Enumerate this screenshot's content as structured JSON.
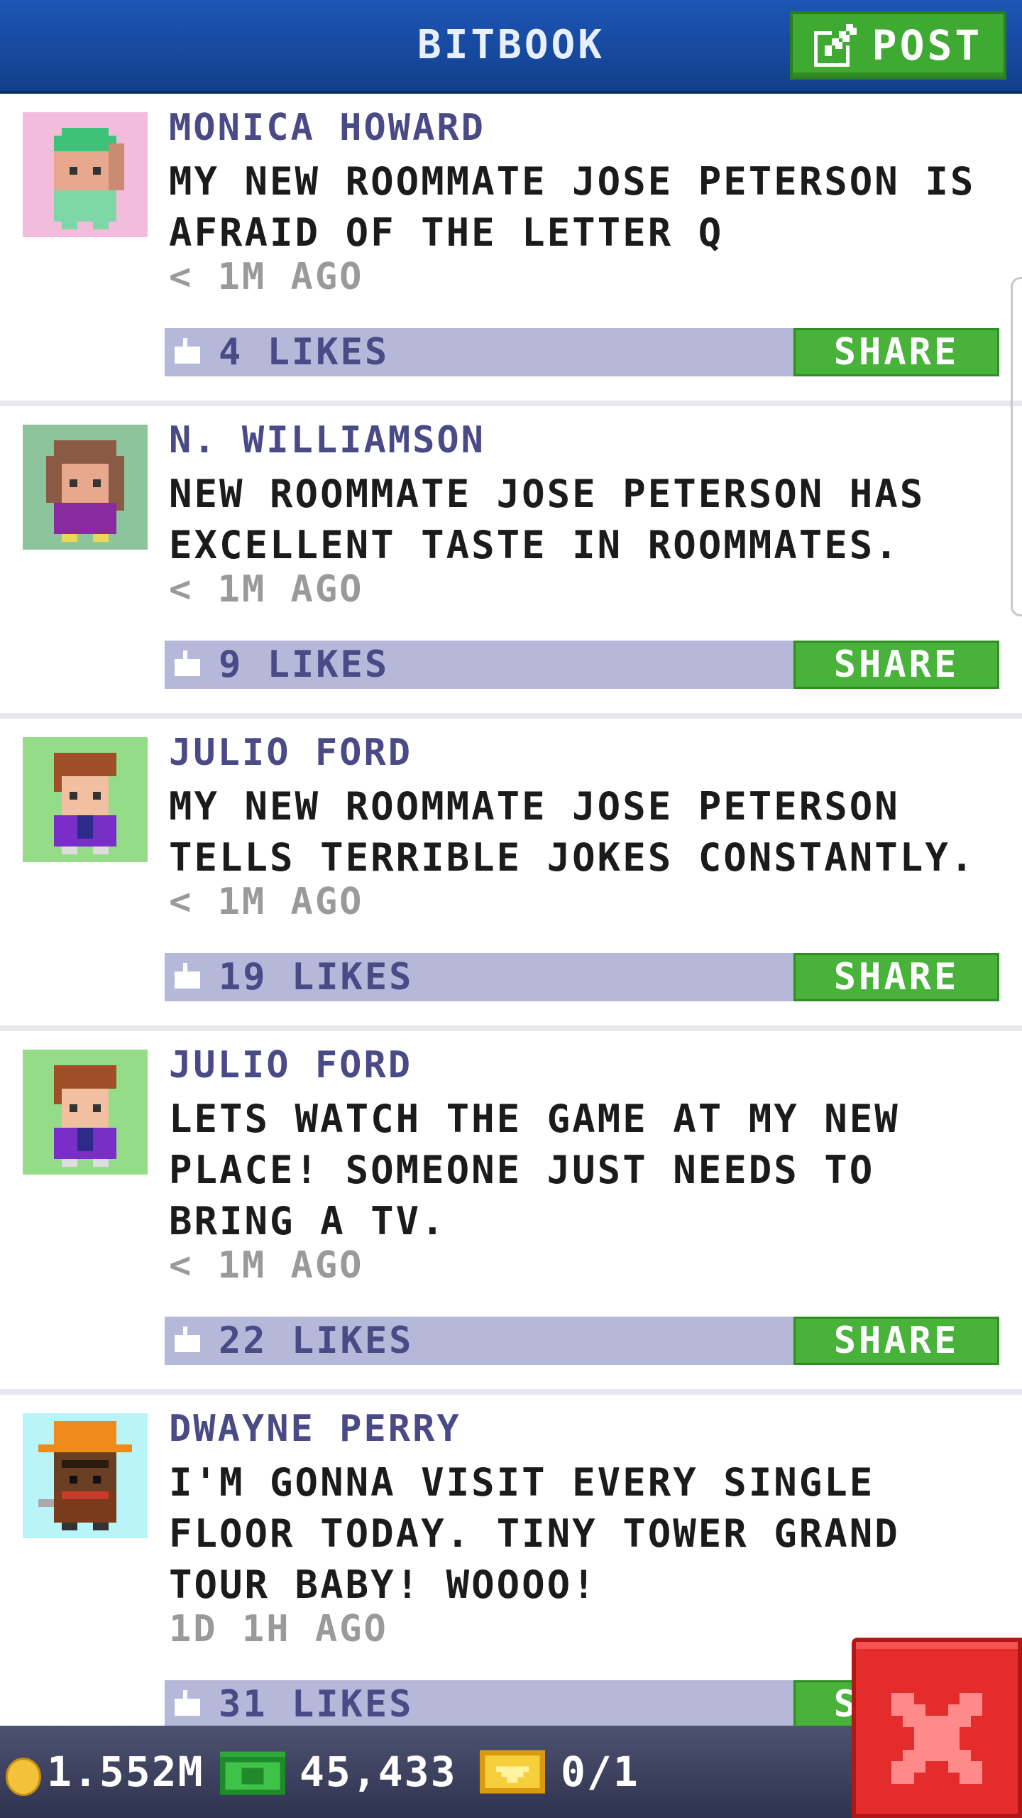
{
  "header": {
    "title": "BITBOOK",
    "post_label": "POST"
  },
  "posts": [
    {
      "author": "MONICA HOWARD",
      "message": "MY NEW ROOMMATE JOSE PETERSON IS AFRAID OF THE LETTER Q",
      "time": "< 1M AGO",
      "likes": "4 LIKES",
      "share": "SHARE",
      "avatar_bg": "#f4bcdc"
    },
    {
      "author": "N. WILLIAMSON",
      "message": "NEW ROOMMATE JOSE PETERSON HAS EXCELLENT TASTE IN ROOMMATES.",
      "time": "< 1M AGO",
      "likes": "9 LIKES",
      "share": "SHARE",
      "avatar_bg": "#8cc49b"
    },
    {
      "author": "JULIO FORD",
      "message": "MY NEW ROOMMATE JOSE PETERSON TELLS TERRIBLE JOKES CONSTANTLY.",
      "time": "< 1M AGO",
      "likes": "19 LIKES",
      "share": "SHARE",
      "avatar_bg": "#94dc88"
    },
    {
      "author": "JULIO FORD",
      "message": "LETS WATCH THE GAME AT MY NEW PLACE! SOMEONE JUST NEEDS TO BRING A TV.",
      "time": "< 1M AGO",
      "likes": "22 LIKES",
      "share": "SHARE",
      "avatar_bg": "#94dc88"
    },
    {
      "author": "DWAYNE PERRY",
      "message": "I'M GONNA VISIT EVERY SINGLE FLOOR TODAY. TINY TOWER GRAND TOUR BABY! WOOOO!",
      "time": "1D 1H AGO",
      "likes": "31 LIKES",
      "share": "SHARE",
      "avatar_bg": "#b9f4f8"
    }
  ],
  "footer": {
    "coins": "1.552M",
    "bux": "45,433",
    "vip": "0/1"
  },
  "colors": {
    "header": "#1d56b6",
    "post_button": "#3faa31",
    "like_bar": "#b5b8d9",
    "share": "#48b23a",
    "close": "#e52c2c"
  }
}
